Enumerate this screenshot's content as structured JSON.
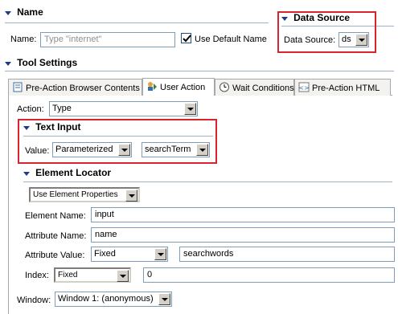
{
  "name_section": {
    "title": "Name",
    "name_label": "Name:",
    "name_placeholder": "Type \"internet\"",
    "use_default_label": "Use Default Name",
    "use_default_checked": true
  },
  "data_source": {
    "title": "Data Source",
    "label": "Data Source:",
    "value": "ds"
  },
  "tool_settings": {
    "title": "Tool Settings",
    "tabs": [
      {
        "label": "Pre-Action Browser Contents",
        "icon": "page-icon"
      },
      {
        "label": "User Action",
        "icon": "user-action-icon"
      },
      {
        "label": "Wait Conditions",
        "icon": "clock-icon"
      },
      {
        "label": "Pre-Action HTML",
        "icon": "html-icon"
      }
    ],
    "active_tab": 1,
    "action_label": "Action:",
    "action_value": "Type"
  },
  "text_input": {
    "title": "Text Input",
    "value_label": "Value:",
    "value_type": "Parameterized",
    "parameter": "searchTerm"
  },
  "element_locator": {
    "title": "Element Locator",
    "mode": "Use Element Properties",
    "element_name_label": "Element Name:",
    "element_name_value": "input",
    "attribute_name_label": "Attribute Name:",
    "attribute_name_value": "name",
    "attribute_value_label": "Attribute Value:",
    "attribute_value_type": "Fixed",
    "attribute_value": "searchwords",
    "index_label": "Index:",
    "index_type": "Fixed",
    "index_value": "0"
  },
  "window": {
    "label": "Window:",
    "value": "Window 1: (anonymous)"
  },
  "colors": {
    "highlight_border": "#d9232f",
    "section_triangle": "#1c3c86",
    "divider": "#9fb2c9"
  }
}
